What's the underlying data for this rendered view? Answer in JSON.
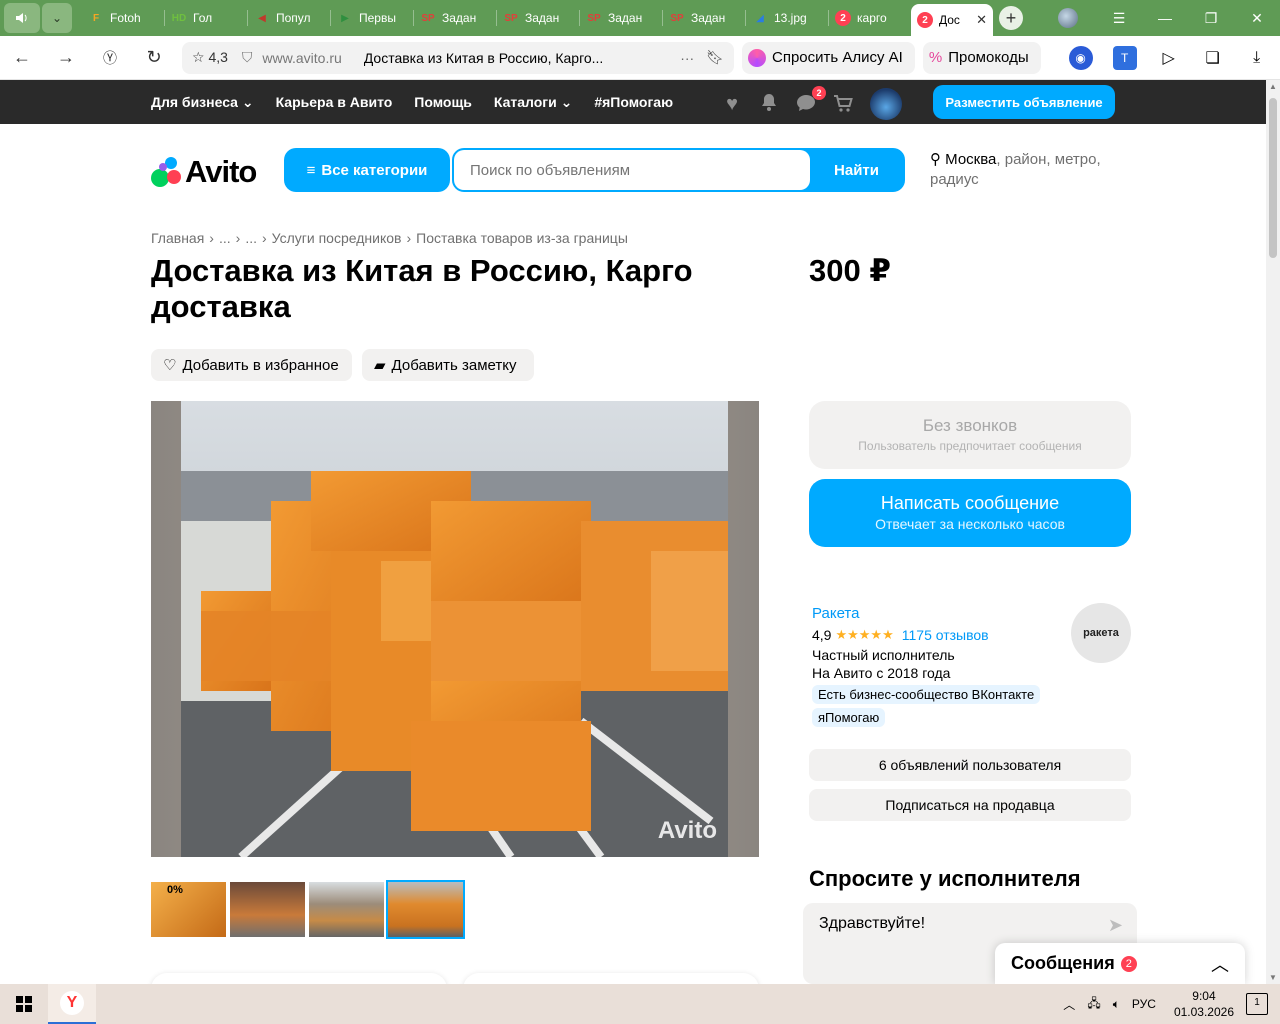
{
  "browser": {
    "tabs": [
      {
        "label": "Fotoh",
        "fav": "F",
        "fav_color": "#f5a623"
      },
      {
        "label": "Гол",
        "fav": "HD",
        "fav_color": "#6fbf3f"
      },
      {
        "label": "Попул",
        "fav": "◀",
        "fav_color": "#c0392b"
      },
      {
        "label": "Первы",
        "fav": "▶",
        "fav_color": "#2f8f3f"
      },
      {
        "label": "Задан",
        "fav": "SP",
        "fav_color": "#e0403a"
      },
      {
        "label": "Задан",
        "fav": "SP",
        "fav_color": "#e0403a"
      },
      {
        "label": "Задан",
        "fav": "SP",
        "fav_color": "#e0403a"
      },
      {
        "label": "Задан",
        "fav": "SP",
        "fav_color": "#e0403a"
      },
      {
        "label": "13.jpg",
        "fav": "◢",
        "fav_color": "#2a7de1"
      },
      {
        "label": "карго",
        "fav": "2",
        "fav_color": "#ff4053"
      },
      {
        "label": "Дос",
        "fav": "2",
        "fav_color": "#ff4053",
        "active": true
      }
    ],
    "address": {
      "rating": "4,3",
      "domain": "www.avito.ru",
      "page_title": "Доставка из Китая в Россию, Карго...",
      "ask_alice": "Спросить Алису AI",
      "promocodes": "Промокоды"
    }
  },
  "topnav": {
    "links": [
      "Для бизнеса",
      "Карьера в Авито",
      "Помощь",
      "Каталоги",
      "#яПомогаю"
    ],
    "messages_badge": "2",
    "post_ad": "Разместить объявление"
  },
  "search": {
    "logo": "Avito",
    "all_categories": "Все категории",
    "placeholder": "Поиск по объявлениям",
    "find": "Найти",
    "location_city": "Москва",
    "location_rest": ", район, метро, радиус"
  },
  "breadcrumbs": [
    "Главная",
    "...",
    "...",
    "Услуги посредников",
    "Поставка товаров из-за границы"
  ],
  "listing": {
    "title": "Доставка из Китая в Россию, Карго доставка",
    "price": "300 ₽",
    "add_favorite": "Добавить в избранное",
    "add_note": "Добавить заметку",
    "watermark": "Avito",
    "thumb1_label": "0%"
  },
  "contact": {
    "no_calls": "Без звонков",
    "no_calls_sub": "Пользователь предпочитает сообщения",
    "write": "Написать сообщение",
    "write_sub": "Отвечает за несколько часов"
  },
  "seller": {
    "name": "Ракета",
    "rating": "4,9",
    "stars": "★★★★★",
    "reviews": "1175 отзывов",
    "type": "Частный исполнитель",
    "since": "На Авито с 2018 года",
    "tag1": "Есть бизнес-сообщество ВКонтакте",
    "tag2": "яПомогаю",
    "logo_text": "ракета",
    "ads": "6 объявлений пользователя",
    "subscribe": "Подписаться на продавца"
  },
  "ask": {
    "heading": "Спросите у исполнителя",
    "message": "Здравствуйте!"
  },
  "messages_popup": {
    "label": "Сообщения",
    "count": "2"
  },
  "taskbar": {
    "lang": "РУС",
    "time": "9:04",
    "date": "01.03.2026",
    "notif_count": "1"
  }
}
